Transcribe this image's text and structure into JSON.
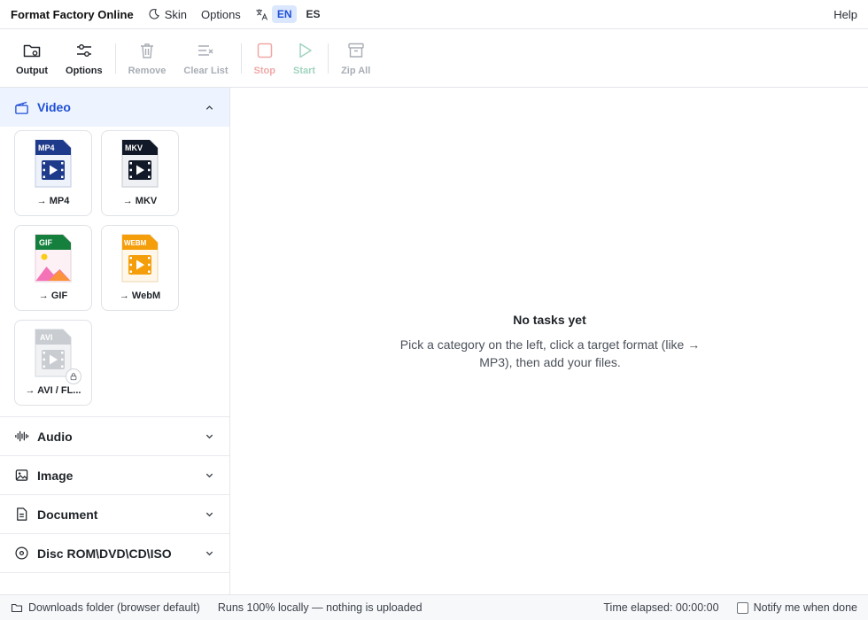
{
  "menubar": {
    "title": "Format Factory Online",
    "skin": "Skin",
    "options": "Options",
    "languages": [
      {
        "code": "EN",
        "active": true
      },
      {
        "code": "ES",
        "active": false
      }
    ],
    "help": "Help"
  },
  "toolbar": {
    "output": "Output",
    "options": "Options",
    "remove": "Remove",
    "clear_list": "Clear List",
    "stop": "Stop",
    "start": "Start",
    "zip_all": "Zip All"
  },
  "sidebar": {
    "video": {
      "label": "Video",
      "formats": [
        {
          "badge": "MP4",
          "label": "→ MP4",
          "color": "#1e3a8a"
        },
        {
          "badge": "MKV",
          "label": "→ MKV",
          "color": "#111827"
        },
        {
          "badge": "GIF",
          "label": "→ GIF",
          "color": "#15803d"
        },
        {
          "badge": "WEBM",
          "label": "→ WebM",
          "color": "#f59e0b"
        },
        {
          "badge": "AVI",
          "label": "→ AVI / FL...",
          "color": "#c9ccd1",
          "locked": true
        }
      ]
    },
    "categories": [
      "Audio",
      "Image",
      "Document",
      "Disc ROM\\DVD\\CD\\ISO"
    ]
  },
  "main": {
    "empty_title": "No tasks yet",
    "empty_message": "Pick a category on the left, click a target format (like → MP3), then add your files."
  },
  "status": {
    "downloads": "Downloads folder (browser default)",
    "local": "Runs 100% locally — nothing is uploaded",
    "elapsed": "Time elapsed: 00:00:00",
    "notify": "Notify me when done"
  },
  "colors": {
    "accent": "#1f4fd6",
    "accent_bg": "#eef4ff",
    "stop": "#f0a8a8",
    "start": "#9fd4be"
  }
}
